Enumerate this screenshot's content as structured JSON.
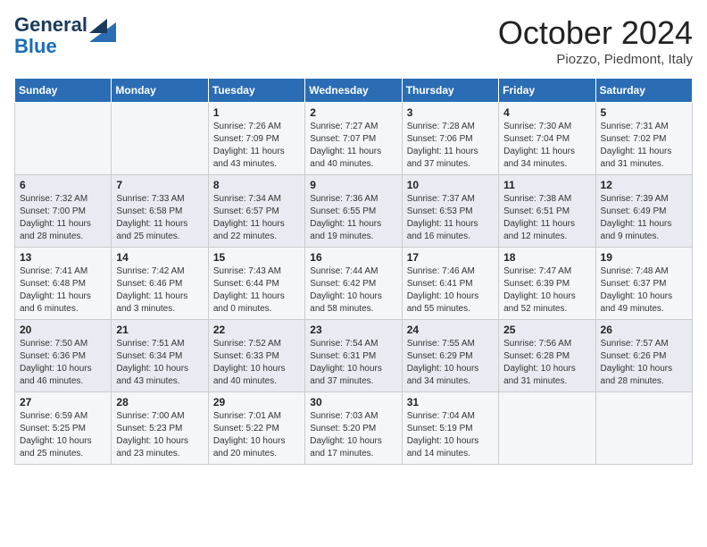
{
  "header": {
    "logo_line1": "General",
    "logo_line2": "Blue",
    "month_title": "October 2024",
    "location": "Piozzo, Piedmont, Italy"
  },
  "weekdays": [
    "Sunday",
    "Monday",
    "Tuesday",
    "Wednesday",
    "Thursday",
    "Friday",
    "Saturday"
  ],
  "weeks": [
    [
      {
        "day": "",
        "info": ""
      },
      {
        "day": "",
        "info": ""
      },
      {
        "day": "1",
        "info": "Sunrise: 7:26 AM\nSunset: 7:09 PM\nDaylight: 11 hours and 43 minutes."
      },
      {
        "day": "2",
        "info": "Sunrise: 7:27 AM\nSunset: 7:07 PM\nDaylight: 11 hours and 40 minutes."
      },
      {
        "day": "3",
        "info": "Sunrise: 7:28 AM\nSunset: 7:06 PM\nDaylight: 11 hours and 37 minutes."
      },
      {
        "day": "4",
        "info": "Sunrise: 7:30 AM\nSunset: 7:04 PM\nDaylight: 11 hours and 34 minutes."
      },
      {
        "day": "5",
        "info": "Sunrise: 7:31 AM\nSunset: 7:02 PM\nDaylight: 11 hours and 31 minutes."
      }
    ],
    [
      {
        "day": "6",
        "info": "Sunrise: 7:32 AM\nSunset: 7:00 PM\nDaylight: 11 hours and 28 minutes."
      },
      {
        "day": "7",
        "info": "Sunrise: 7:33 AM\nSunset: 6:58 PM\nDaylight: 11 hours and 25 minutes."
      },
      {
        "day": "8",
        "info": "Sunrise: 7:34 AM\nSunset: 6:57 PM\nDaylight: 11 hours and 22 minutes."
      },
      {
        "day": "9",
        "info": "Sunrise: 7:36 AM\nSunset: 6:55 PM\nDaylight: 11 hours and 19 minutes."
      },
      {
        "day": "10",
        "info": "Sunrise: 7:37 AM\nSunset: 6:53 PM\nDaylight: 11 hours and 16 minutes."
      },
      {
        "day": "11",
        "info": "Sunrise: 7:38 AM\nSunset: 6:51 PM\nDaylight: 11 hours and 12 minutes."
      },
      {
        "day": "12",
        "info": "Sunrise: 7:39 AM\nSunset: 6:49 PM\nDaylight: 11 hours and 9 minutes."
      }
    ],
    [
      {
        "day": "13",
        "info": "Sunrise: 7:41 AM\nSunset: 6:48 PM\nDaylight: 11 hours and 6 minutes."
      },
      {
        "day": "14",
        "info": "Sunrise: 7:42 AM\nSunset: 6:46 PM\nDaylight: 11 hours and 3 minutes."
      },
      {
        "day": "15",
        "info": "Sunrise: 7:43 AM\nSunset: 6:44 PM\nDaylight: 11 hours and 0 minutes."
      },
      {
        "day": "16",
        "info": "Sunrise: 7:44 AM\nSunset: 6:42 PM\nDaylight: 10 hours and 58 minutes."
      },
      {
        "day": "17",
        "info": "Sunrise: 7:46 AM\nSunset: 6:41 PM\nDaylight: 10 hours and 55 minutes."
      },
      {
        "day": "18",
        "info": "Sunrise: 7:47 AM\nSunset: 6:39 PM\nDaylight: 10 hours and 52 minutes."
      },
      {
        "day": "19",
        "info": "Sunrise: 7:48 AM\nSunset: 6:37 PM\nDaylight: 10 hours and 49 minutes."
      }
    ],
    [
      {
        "day": "20",
        "info": "Sunrise: 7:50 AM\nSunset: 6:36 PM\nDaylight: 10 hours and 46 minutes."
      },
      {
        "day": "21",
        "info": "Sunrise: 7:51 AM\nSunset: 6:34 PM\nDaylight: 10 hours and 43 minutes."
      },
      {
        "day": "22",
        "info": "Sunrise: 7:52 AM\nSunset: 6:33 PM\nDaylight: 10 hours and 40 minutes."
      },
      {
        "day": "23",
        "info": "Sunrise: 7:54 AM\nSunset: 6:31 PM\nDaylight: 10 hours and 37 minutes."
      },
      {
        "day": "24",
        "info": "Sunrise: 7:55 AM\nSunset: 6:29 PM\nDaylight: 10 hours and 34 minutes."
      },
      {
        "day": "25",
        "info": "Sunrise: 7:56 AM\nSunset: 6:28 PM\nDaylight: 10 hours and 31 minutes."
      },
      {
        "day": "26",
        "info": "Sunrise: 7:57 AM\nSunset: 6:26 PM\nDaylight: 10 hours and 28 minutes."
      }
    ],
    [
      {
        "day": "27",
        "info": "Sunrise: 6:59 AM\nSunset: 5:25 PM\nDaylight: 10 hours and 25 minutes."
      },
      {
        "day": "28",
        "info": "Sunrise: 7:00 AM\nSunset: 5:23 PM\nDaylight: 10 hours and 23 minutes."
      },
      {
        "day": "29",
        "info": "Sunrise: 7:01 AM\nSunset: 5:22 PM\nDaylight: 10 hours and 20 minutes."
      },
      {
        "day": "30",
        "info": "Sunrise: 7:03 AM\nSunset: 5:20 PM\nDaylight: 10 hours and 17 minutes."
      },
      {
        "day": "31",
        "info": "Sunrise: 7:04 AM\nSunset: 5:19 PM\nDaylight: 10 hours and 14 minutes."
      },
      {
        "day": "",
        "info": ""
      },
      {
        "day": "",
        "info": ""
      }
    ]
  ]
}
